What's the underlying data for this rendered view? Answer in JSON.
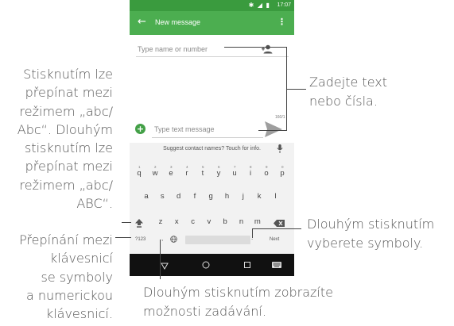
{
  "status_bar": {
    "time": "17:07",
    "icons": [
      "bluetooth-icon",
      "signal-icon",
      "battery-icon"
    ]
  },
  "app_bar": {
    "back_icon": "arrow-left-icon",
    "title": "New message",
    "menu_icon": "more-vert-icon"
  },
  "recipient_field": {
    "placeholder": "Type name or number",
    "icon": "add-contact-icon"
  },
  "compose": {
    "char_counter": "160/1",
    "add_icon": "plus-icon",
    "placeholder": "Type text message",
    "send_icon": "send-icon"
  },
  "keyboard": {
    "suggestion": "Suggest contact names? Touch for info.",
    "row1": [
      {
        "num": "1",
        "key": "q"
      },
      {
        "num": "2",
        "key": "w"
      },
      {
        "num": "3",
        "key": "e"
      },
      {
        "num": "4",
        "key": "r"
      },
      {
        "num": "5",
        "key": "t"
      },
      {
        "num": "6",
        "key": "y"
      },
      {
        "num": "7",
        "key": "u"
      },
      {
        "num": "8",
        "key": "i"
      },
      {
        "num": "9",
        "key": "o"
      },
      {
        "num": "0",
        "key": "p"
      }
    ],
    "row2": [
      "a",
      "s",
      "d",
      "f",
      "g",
      "h",
      "j",
      "k",
      "l"
    ],
    "row3": [
      "z",
      "x",
      "c",
      "v",
      "b",
      "n",
      "m"
    ],
    "symbols_key": "?123",
    "comma_key": ",",
    "period_key": ".",
    "next_key": "Next"
  },
  "nav_bar": {
    "icons": [
      "back-triangle-icon",
      "home-circle-icon",
      "recents-square-icon",
      "keyboard-switch-icon"
    ]
  },
  "callouts": {
    "left_top": [
      "Stisknutím lze",
      "přepínat mezi",
      "režimem „abc/",
      "Abc“. Dlouhým",
      "stisknutím lze",
      "přepínat mezi",
      "režimem „abc/",
      "ABC“."
    ],
    "left_bottom": [
      "Přepínání mezi",
      "klávesnicí",
      "se symboly",
      "a numerickou",
      "klávesnicí."
    ],
    "right_top": [
      "Zadejte text",
      "nebo čísla."
    ],
    "right_bottom": [
      "Dlouhým stisknutím",
      "vyberete symboly."
    ],
    "bottom": [
      "Dlouhým stisknutím zobrazíte",
      "možnosti zadávání."
    ]
  },
  "colors": {
    "status_bar": "#3a9b3e",
    "app_bar": "#4cae50",
    "accent": "#43a047",
    "keyboard_bg": "#f2f2f2",
    "nav_bar": "#111111",
    "callout_text": "#555555"
  }
}
